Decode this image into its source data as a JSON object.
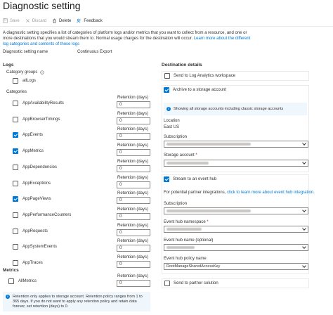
{
  "page": {
    "title": "Diagnostic setting"
  },
  "toolbar": {
    "save_label": "Save",
    "discard_label": "Discard",
    "delete_label": "Delete",
    "feedback_label": "Feedback"
  },
  "description": {
    "text": "A diagnostic setting specifies a list of categories of platform logs and/or metrics that you want to collect from a resource, and one or more destinations that you would stream them to. Normal usage charges for the destination will occur.",
    "link": "Learn more about the different log categories and contents of those logs"
  },
  "setting_name": {
    "label": "Diagnostic setting name",
    "value": "Continuous Export"
  },
  "logs": {
    "title": "Logs",
    "category_groups_label": "Category groups",
    "all_logs_label": "allLogs",
    "categories_label": "Categories",
    "retention_label": "Retention (days)",
    "categories": [
      {
        "name": "AppAvailabilityResults",
        "checked": false,
        "retention": "0"
      },
      {
        "name": "AppBrowserTimings",
        "checked": false,
        "retention": "0"
      },
      {
        "name": "AppEvents",
        "checked": true,
        "retention": "0"
      },
      {
        "name": "AppMetrics",
        "checked": true,
        "retention": "0"
      },
      {
        "name": "AppDependencies",
        "checked": false,
        "retention": "0"
      },
      {
        "name": "AppExceptions",
        "checked": false,
        "retention": "0"
      },
      {
        "name": "AppPageViews",
        "checked": true,
        "retention": "0"
      },
      {
        "name": "AppPerformanceCounters",
        "checked": false,
        "retention": "0"
      },
      {
        "name": "AppRequests",
        "checked": false,
        "retention": "0"
      },
      {
        "name": "AppSystemEvents",
        "checked": false,
        "retention": "0"
      },
      {
        "name": "AppTraces",
        "checked": false,
        "retention": "0"
      }
    ]
  },
  "metrics": {
    "title": "Metrics",
    "all_metrics_label": "AllMetrics",
    "all_metrics_checked": false,
    "retention_label": "Retention (days)",
    "retention": "0"
  },
  "retention_note": "Retention only applies to storage account. Retention policy ranges from 1 to 365 days. If you do not want to apply any retention policy and retain data forever, set retention (days) to 0.",
  "destination": {
    "title": "Destination details",
    "log_analytics_label": "Send to Log Analytics workspace",
    "log_analytics_checked": false,
    "archive_label": "Archive to a storage account",
    "archive_checked": true,
    "archive_info": "Showing all storage accounts including classic storage accounts",
    "location_label": "Location",
    "location_value": "East US",
    "subscription_label": "Subscription",
    "storage_account_label": "Storage account",
    "event_hub_label": "Stream to an event hub",
    "event_hub_checked": true,
    "partner_text": "For potential partner integrations,",
    "partner_link": "click to learn more about event hub integration.",
    "eh_subscription_label": "Subscription",
    "eh_namespace_label": "Event hub namespace",
    "eh_name_label": "Event hub name (optional)",
    "eh_policy_label": "Event hub policy name",
    "eh_policy_value": "RootManageSharedAccessKey",
    "partner_solution_label": "Send to partner solution",
    "partner_solution_checked": false,
    "required_mark": "*"
  },
  "icons": [
    "save-icon",
    "discard-icon",
    "delete-icon",
    "feedback-icon",
    "info-icon",
    "chevron-down-icon"
  ],
  "colors": {
    "accent": "#0078d4",
    "info_bg": "#eff6fc",
    "border": "#8a8886",
    "text": "#323130"
  }
}
